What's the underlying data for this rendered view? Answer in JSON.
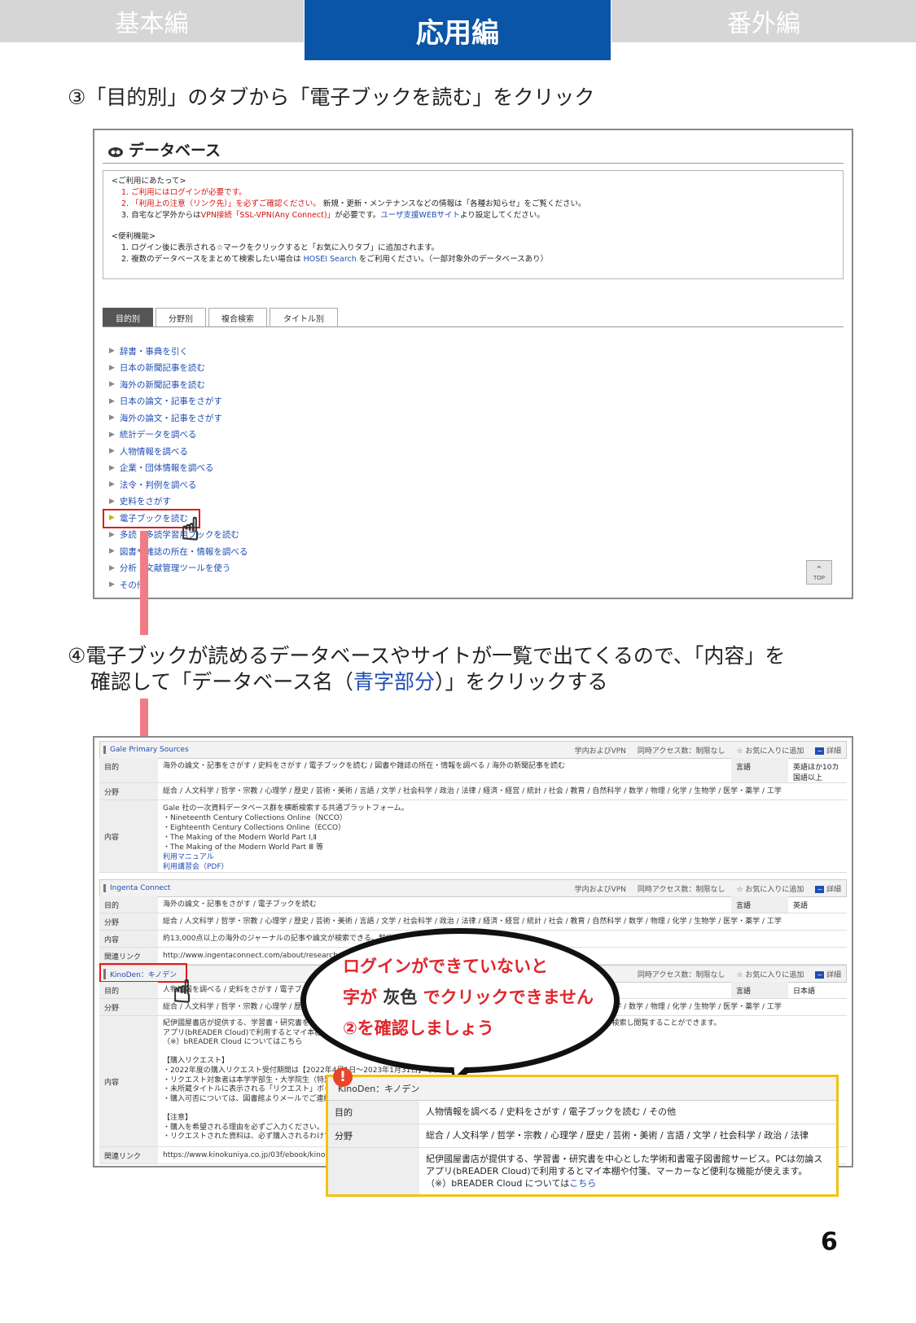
{
  "header": {
    "tabs": [
      {
        "label": "基本編"
      },
      {
        "label": "応用編"
      },
      {
        "label": "番外編"
      }
    ]
  },
  "step3": {
    "text": "③「目的別」のタブから「電子ブックを読む」をクリック"
  },
  "shot1": {
    "title": "データベース",
    "notice": {
      "head1": "<ご利用にあたって>",
      "l1": "1. ご利用にはログインが必要です。",
      "l2a": "2. 「利用上の注意（リンク先）」を必ずご確認ください。",
      "l2b": "新規・更新・メンテナンスなどの情報は「各種お知らせ」をご覧ください。",
      "l3a": "3. 自宅など学外からは",
      "l3b": "VPN接続「SSL-VPN(Any Connect)」",
      "l3c": "が必要です。",
      "l3d": "ユーザ支援WEBサイト",
      "l3e": "より設定してください。",
      "head2": "<便利機能>",
      "l4": "1. ログイン後に表示される☆マークをクリックすると「お気に入りタブ」に追加されます。",
      "l5a": "2. 複数のデータベースをまとめて検索したい場合は",
      "l5b": "HOSEI Search",
      "l5c": "をご利用ください。（一部対象外のデータベースあり）"
    },
    "tabs": [
      "目的別",
      "分野別",
      "複合検索",
      "タイトル別"
    ],
    "purposes": [
      "辞書・事典を引く",
      "日本の新聞記事を読む",
      "海外の新聞記事を読む",
      "日本の論文・記事をさがす",
      "海外の論文・記事をさがす",
      "統計データを調べる",
      "人物情報を調べる",
      "企業・団体情報を調べる",
      "法令・判例を調べる",
      "史料をさがす",
      "電子ブックを読む",
      "多読・多読学習用ブックを読む",
      "図書や雑誌の所在・情報を調べる",
      "分析・文献管理ツールを使う",
      "その他"
    ],
    "top_label": "TOP"
  },
  "step4": {
    "line1": "④電子ブックが読めるデータベースやサイトが一覧で出てくるので、「内容」を",
    "line2a": "確認して「データベース名（",
    "line2b": "青字部分",
    "line2c": "）」をクリックする"
  },
  "shot2": {
    "meta": {
      "access": "学内およびVPN",
      "concurrent": "同時アクセス数：制限なし",
      "fav": "☆ お気に入りに追加",
      "detail": "詳細"
    },
    "labels": {
      "purpose": "目的",
      "field": "分野",
      "content": "内容",
      "related": "関連リンク",
      "lang": "言語"
    },
    "gale": {
      "name": "Gale Primary Sources",
      "purpose": "海外の論文・記事をさがす / 史料をさがす / 電子ブックを読む / 図書や雑誌の所在・情報を調べる / 海外の新聞記事を読む",
      "lang": "英語ほか10カ国語以上",
      "field": "総合 / 人文科学 / 哲学・宗教 / 心理学 / 歴史 / 芸術・美術 / 言語 / 文学 / 社会科学 / 政治 / 法律 / 経済・経営 / 統計 / 社会 / 教育 / 自然科学 / 数学 / 物理 / 化学 / 生物学 / 医学・薬学 / 工学",
      "content": [
        "Gale 社の一次資料データベース群を横断検索する共通プラットフォーム。",
        "・Nineteenth Century Collections Online（NCCO）",
        "・Eighteenth Century Collections Online（ECCO）",
        "・The Making of the Modern World Part Ⅰ,Ⅱ",
        "・The Making of the Modern World Part Ⅲ 等",
        "利用マニュアル",
        "利用講習会（PDF）"
      ]
    },
    "ingenta": {
      "name": "Ingenta Connect",
      "purpose": "海外の論文・記事をさがす / 電子ブックを読む",
      "lang": "英語",
      "field": "総合 / 人文科学 / 哲学・宗教 / 心理学 / 歴史 / 芸術・美術 / 言語 / 文学 / 社会科学 / 政治 / 法律 / 経済・経営 / 統計 / 社会 / 教育 / 自然科学 / 数学 / 物理 / 化学 / 生物学 / 医学・薬学 / 工学",
      "content": "約13,000点以上の海外のジャーナルの記事や論文が検索できる。契約している論文は本文も閲覧可能。",
      "link": "http://www.ingentaconnect.com/about/researchers"
    },
    "kinoden": {
      "name": "KinoDen：キノデン",
      "purpose": "人物情報を調べる / 史料をさがす / 電子ブックを読む / その他",
      "lang": "日本語",
      "field": "総合 / 人文科学 / 哲学・宗教 / 心理学 / 歴史 / 芸術・美術 / 言語 / 文学 / 社会科学 / 政治 / 法律 / 経済・経営 / 統計 / 社会 / 教育 / 自然科学 / 数学 / 物理 / 化学 / 生物学 / 医学・薬学 / 工学",
      "content": [
        "紀伊國屋書店が提供する、学習書・研究書を中心とした学術和書電子図書館サービス。PCは勿論スマートフォンやタブレットでも全文を検索し閲覧することができます。",
        "アプリ(bREADER Cloud)で利用するとマイ本棚や付箋、マーカーなど便利な機能が使えます。",
        "（※）bREADER Cloud についてはこちら",
        "",
        "【購入リクエスト】",
        "・2022年度の購入リクエスト受付期間は【2022年4月1日～2023年1月31日】です。",
        "・リクエスト対象者は本学学部生・大学院生（特別聴講生等含む）です。",
        "・未所蔵タイトルに表示される「リクエスト」ボタンからリクエストできます。",
        "・購入可否については、図書館よりメールでご連絡します。",
        "",
        "【注意】",
        "・購入を希望される理由を必ずご入力ください。",
        "・リクエストされた資料は、必ず購入されるわけではありません。"
      ],
      "link": "https://www.kinokuniya.co.jp/03f/ebook/kinoden"
    }
  },
  "callout": {
    "line1": "ログインができていないと",
    "line2a": "字が",
    "line2b": "灰色",
    "line2c": "でクリックできません",
    "line3": "②を確認しましょう"
  },
  "zoom": {
    "name": "KinoDen：キノデン",
    "purpose_label": "目的",
    "purpose": "人物情報を調べる / 史料をさがす / 電子ブックを読む / その他",
    "field_label": "分野",
    "field": "総合 / 人文科学 / 哲学・宗教 / 心理学 / 歴史 / 芸術・美術 / 言語 / 文学 / 社会科学 / 政治 / 法律",
    "content1": "紀伊國屋書店が提供する、学習書・研究書を中心とした学術和書電子図書館サービス。PCは勿論ス",
    "content2": "アプリ(bREADER Cloud)で利用するとマイ本棚や付箋、マーカーなど便利な機能が使えます。",
    "content3a": "（※）bREADER Cloud については",
    "content3b": "こちら"
  },
  "page_number": "6",
  "colors": {
    "accent": "#0a55a8",
    "tab_inactive": "#d6d6d6",
    "highlight_red": "#e01b1b",
    "arrow_pink": "#f27c85",
    "callout_red": "#e0262b",
    "zoom_border": "#f2c30f",
    "link_blue": "#1f4db3"
  }
}
